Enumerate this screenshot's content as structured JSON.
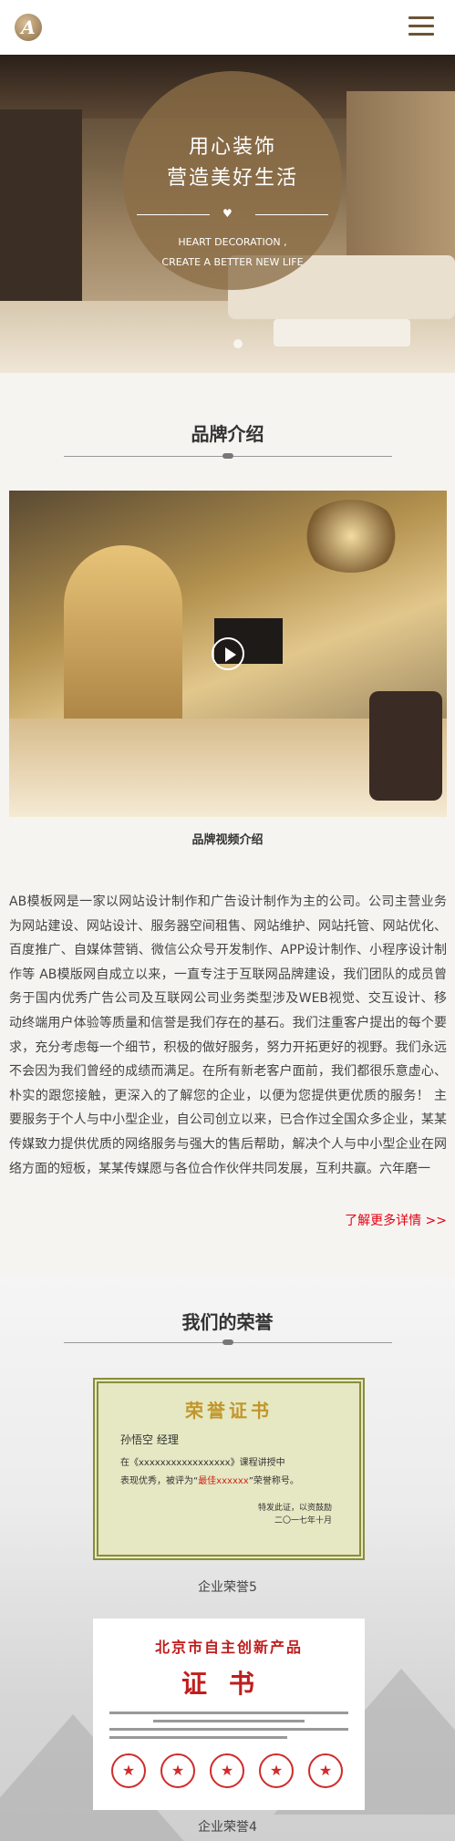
{
  "header": {
    "logo_letter": "A",
    "menu_icon": "hamburger-menu-icon"
  },
  "banner": {
    "title_line1": "用心装饰",
    "title_line2": "营造美好生活",
    "subtitle_line1": "HEART DECORATION ,",
    "subtitle_line2": "CREATE A BETTER NEW LIFE",
    "heart_icon": "heart-icon"
  },
  "brand": {
    "title": "品牌介绍",
    "video_caption": "品牌视频介绍",
    "play_icon": "play-icon",
    "intro": "AB模板网是一家以网站设计制作和广告设计制作为主的公司。公司主营业务为网站建设、网站设计、服务器空间租售、网站维护、网站托管、网站优化、百度推广、自媒体营销、微信公众号开发制作、APP设计制作、小程序设计制作等 AB模版网自成立以来，一直专注于互联网品牌建设，我们团队的成员曾务于国内优秀广告公司及互联网公司业务类型涉及WEB视觉、交互设计、移动终端用户体验等质量和信誉是我们存在的基石。我们注重客户提出的每个要求，充分考虑每一个细节，积极的做好服务，努力开拓更好的视野。我们永远不会因为我们曾经的成绩而满足。在所有新老客户面前，我们都很乐意虚心、朴实的跟您接触，更深入的了解您的企业，以便为您提供更优质的服务！ 主要服务于个人与中小型企业，自公司创立以来，已合作过全国众多企业，某某传媒致力提供优质的网络服务与强大的售后帮助，解决个人与中小型企业在网络方面的短板，某某传媒愿与各位合作伙伴共同发展，互利共赢。六年磨一",
    "more_link": "了解更多详情 >>"
  },
  "honors": {
    "title": "我们的荣誉",
    "items": [
      {
        "caption": "企业荣誉5",
        "cert_title": "荣誉证书",
        "cert_name": "孙悟空",
        "cert_role": "经理",
        "cert_body_1": "在《xxxxxxxxxxxxxxxxx》课程讲授中",
        "cert_body_2": "表现优秀，被评为“",
        "cert_highlight": "最佳xxxxxx",
        "cert_body_3": "”荣誉称号。",
        "cert_sign": "特发此证，以资鼓励",
        "cert_date": "二〇一七年十月"
      },
      {
        "caption": "企业荣誉4",
        "cert_head": "北京市自主创新产品",
        "cert_big": "证书"
      }
    ]
  }
}
